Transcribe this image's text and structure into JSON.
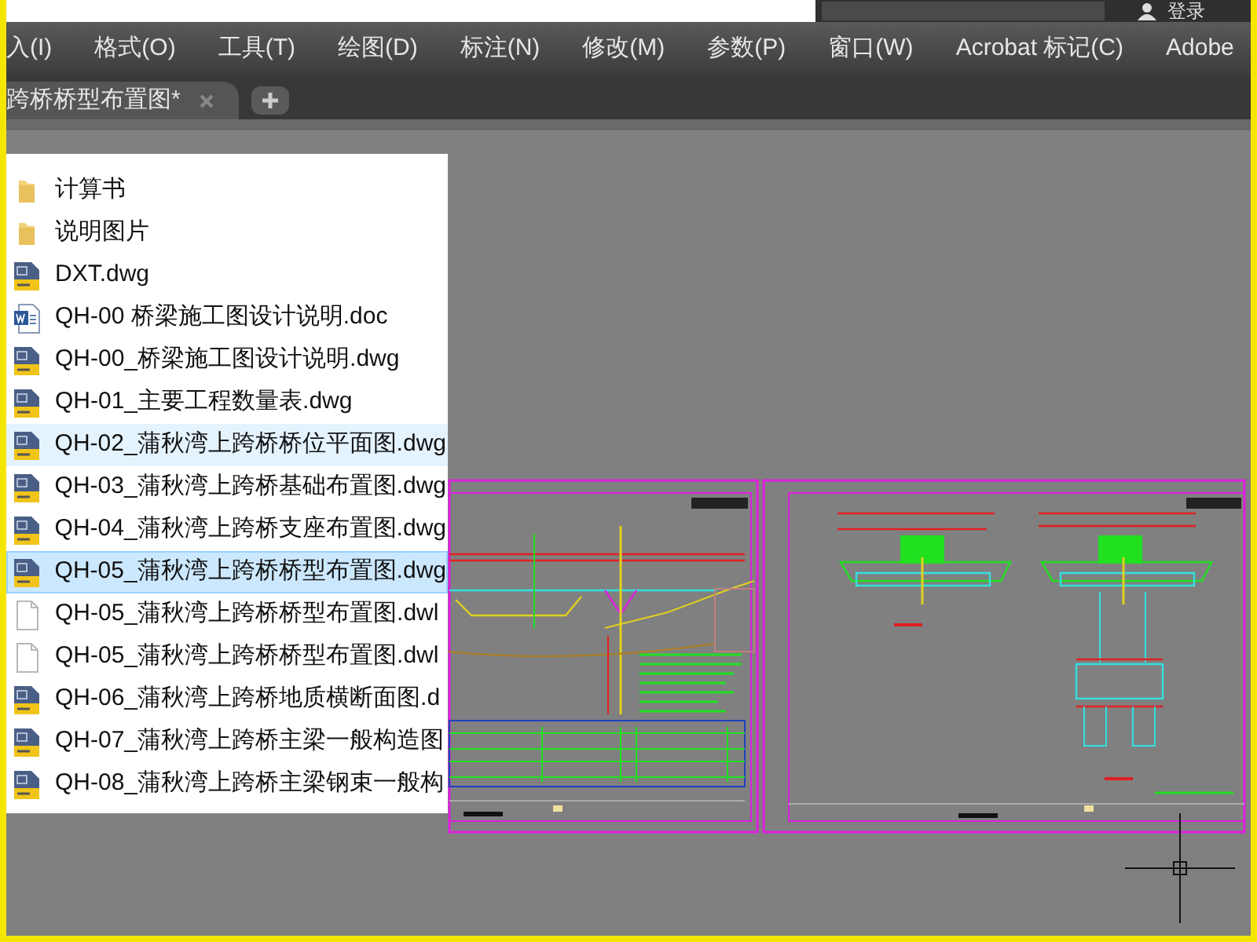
{
  "title_bar": {
    "login": "登录"
  },
  "menu": [
    "入(I)",
    "格式(O)",
    "工具(T)",
    "绘图(D)",
    "标注(N)",
    "修改(M)",
    "参数(P)",
    "窗口(W)",
    "Acrobat 标记(C)",
    "Adobe"
  ],
  "tabs": [
    {
      "label": "跨桥桥型布置图*",
      "selected": true
    }
  ],
  "files": [
    {
      "name": "计算书",
      "kind": "folder",
      "selected": false,
      "hovered": false
    },
    {
      "name": "说明图片",
      "kind": "folder",
      "selected": false,
      "hovered": false
    },
    {
      "name": "DXT.dwg",
      "kind": "dwg",
      "selected": false,
      "hovered": false
    },
    {
      "name": "QH-00 桥梁施工图设计说明.doc",
      "kind": "doc",
      "selected": false,
      "hovered": false
    },
    {
      "name": "QH-00_桥梁施工图设计说明.dwg",
      "kind": "dwg",
      "selected": false,
      "hovered": false
    },
    {
      "name": "QH-01_主要工程数量表.dwg",
      "kind": "dwg",
      "selected": false,
      "hovered": false
    },
    {
      "name": "QH-02_蒲秋湾上跨桥桥位平面图.dwg",
      "kind": "dwg",
      "selected": false,
      "hovered": true
    },
    {
      "name": "QH-03_蒲秋湾上跨桥基础布置图.dwg",
      "kind": "dwg",
      "selected": false,
      "hovered": false
    },
    {
      "name": "QH-04_蒲秋湾上跨桥支座布置图.dwg",
      "kind": "dwg",
      "selected": false,
      "hovered": false
    },
    {
      "name": "QH-05_蒲秋湾上跨桥桥型布置图.dwg",
      "kind": "dwg",
      "selected": true,
      "hovered": false
    },
    {
      "name": "QH-05_蒲秋湾上跨桥桥型布置图.dwl",
      "kind": "blank",
      "selected": false,
      "hovered": false
    },
    {
      "name": "QH-05_蒲秋湾上跨桥桥型布置图.dwl",
      "kind": "blank",
      "selected": false,
      "hovered": false
    },
    {
      "name": "QH-06_蒲秋湾上跨桥地质横断面图.d",
      "kind": "dwg",
      "selected": false,
      "hovered": false
    },
    {
      "name": "QH-07_蒲秋湾上跨桥主梁一般构造图",
      "kind": "dwg",
      "selected": false,
      "hovered": false
    },
    {
      "name": "QH-08_蒲秋湾上跨桥主梁钢束一般构",
      "kind": "dwg",
      "selected": false,
      "hovered": false
    }
  ]
}
